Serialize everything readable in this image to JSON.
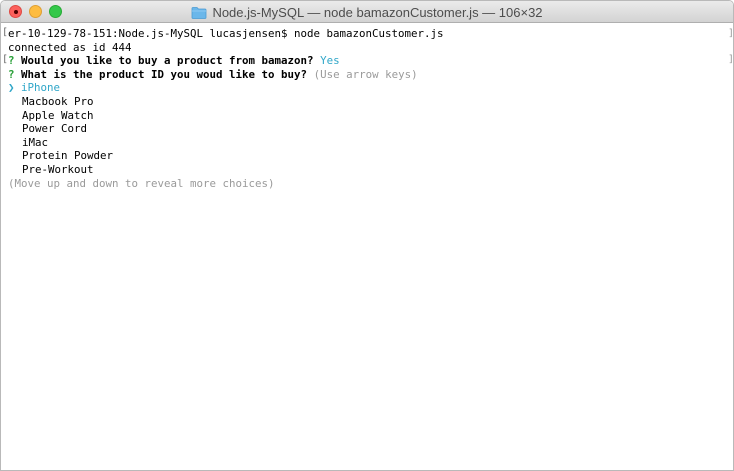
{
  "window": {
    "title": "Node.js-MySQL — node bamazonCustomer.js — 106×32"
  },
  "icons": {
    "folder": "folder-icon",
    "pointer": "pointer-icon"
  },
  "colors": {
    "question_mark": "#2aa039",
    "answer": "#2fa6c8",
    "hint": "#9a9a9a"
  },
  "terminal": {
    "prompt_line": "er-10-129-78-151:Node.js-MySQL lucasjensen$ node bamazonCustomer.js",
    "connected_line": "connected as id 444",
    "q1": {
      "mark": "?",
      "text": "Would you like to buy a product from bamazon?",
      "answer": "Yes"
    },
    "q2": {
      "mark": "?",
      "text": "What is the product ID you woud like to buy?",
      "hint": "(Use arrow keys)"
    },
    "pointer": "❯",
    "choices": [
      "iPhone",
      "Macbook Pro",
      "Apple Watch",
      "Power Cord",
      "iMac",
      "Protein Powder",
      "Pre-Workout"
    ],
    "more_hint": "(Move up and down to reveal more choices)"
  }
}
